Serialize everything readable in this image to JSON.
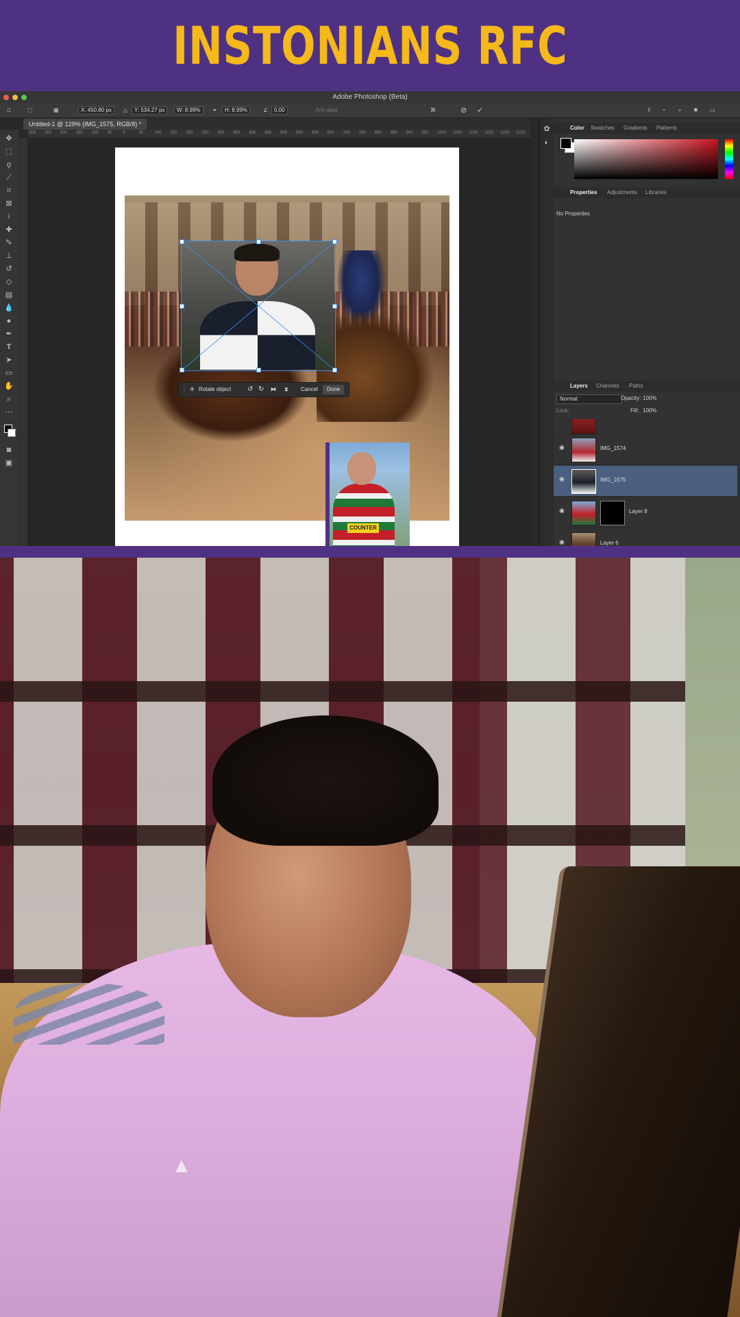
{
  "banner": {
    "title": "INSTONIANS RFC"
  },
  "photoshop": {
    "window_title": "Adobe Photoshop (Beta)",
    "options": {
      "x": "X: 450.80 px",
      "y": "Y: 534.27 px",
      "w": "W: 8.99%",
      "h": "H: 8.99%",
      "angle": "0.00",
      "antialias": "Anti-alias"
    },
    "document_tab": "Untitled-1 @ 129% (IMG_1575, RGB/8) *",
    "ruler_ticks": [
      "300",
      "250",
      "200",
      "150",
      "100",
      "50",
      "0",
      "50",
      "100",
      "150",
      "200",
      "250",
      "300",
      "350",
      "400",
      "450",
      "500",
      "550",
      "600",
      "650",
      "700",
      "750",
      "800",
      "850",
      "900",
      "950",
      "1000",
      "1050",
      "1100",
      "1150",
      "1200",
      "1250"
    ],
    "context_bar": {
      "rotate": "Rotate object",
      "cancel": "Cancel",
      "done": "Done"
    },
    "thumb_sponsor": "COUNTER",
    "panels": {
      "color_tabs": [
        "Color",
        "Swatches",
        "Gradients",
        "Patterns"
      ],
      "prop_tabs": [
        "Properties",
        "Adjustments",
        "Libraries"
      ],
      "no_properties": "No Properties",
      "layer_tabs": [
        "Layers",
        "Channels",
        "Paths"
      ],
      "blend_mode": "Normal",
      "opacity_label": "Opacity:",
      "opacity_value": "100%",
      "lock_label": "Lock:",
      "fill_label": "Fill:",
      "fill_value": "100%",
      "layers": [
        {
          "name": "IMG_1574"
        },
        {
          "name": "IMG_1575"
        },
        {
          "name": "Layer 8"
        },
        {
          "name": "Layer 6"
        }
      ]
    },
    "colors": {
      "brand_purple": "#4f3184",
      "brand_gold": "#f5b919",
      "selection_blue": "#3b8ef0"
    }
  }
}
